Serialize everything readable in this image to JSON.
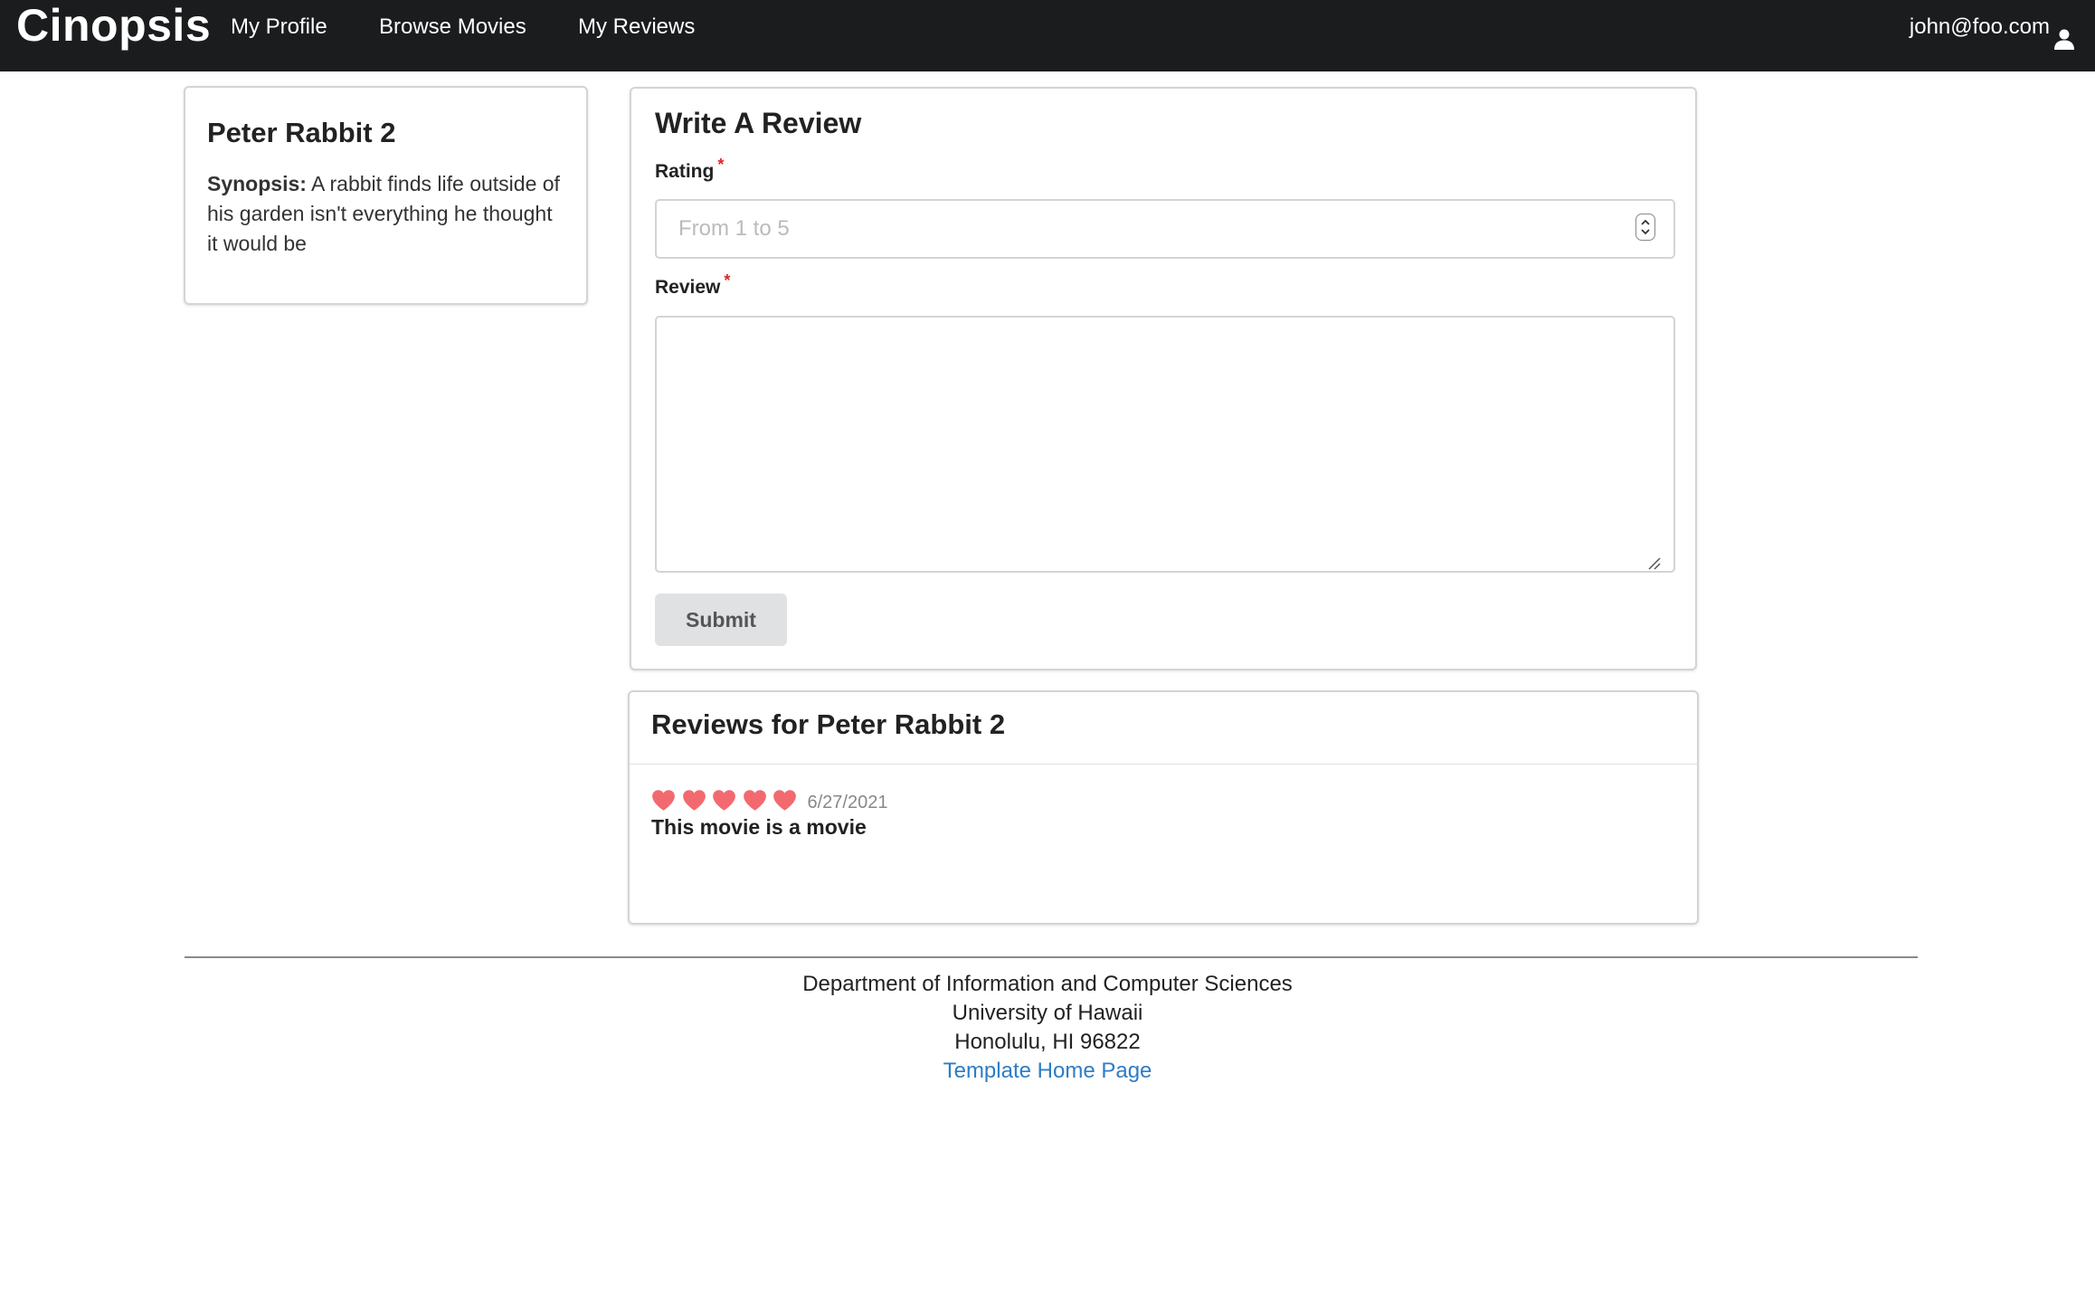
{
  "navbar": {
    "brand": "Cinopsis",
    "links": [
      "My Profile",
      "Browse Movies",
      "My Reviews"
    ],
    "user_email": "john@foo.com",
    "user_icon": "user-icon"
  },
  "movie": {
    "title": "Peter Rabbit 2",
    "synopsis_label": "Synopsis:",
    "synopsis_text": "A rabbit finds life outside of his garden isn't everything he thought it would be"
  },
  "review_form": {
    "title": "Write A Review",
    "rating_label": "Rating",
    "rating_placeholder": "From 1 to 5",
    "rating_value": "",
    "required_marker": "*",
    "review_label": "Review",
    "review_value": "",
    "submit_label": "Submit"
  },
  "reviews": {
    "header": "Reviews for Peter Rabbit 2",
    "items": [
      {
        "rating": 5,
        "rating_icon": "heart-icon",
        "date": "6/27/2021",
        "text": "This movie is a movie"
      }
    ]
  },
  "footer": {
    "line1": "Department of Information and Computer Sciences",
    "line2": "University of Hawaii",
    "line3": "Honolulu, HI 96822",
    "link_text": "Template Home Page"
  },
  "colors": {
    "navbar_bg": "#1b1c1d",
    "heart": "#f26a6f",
    "required": "#db2828",
    "link": "#2e7cc4",
    "submit_bg": "#e0e1e2"
  }
}
